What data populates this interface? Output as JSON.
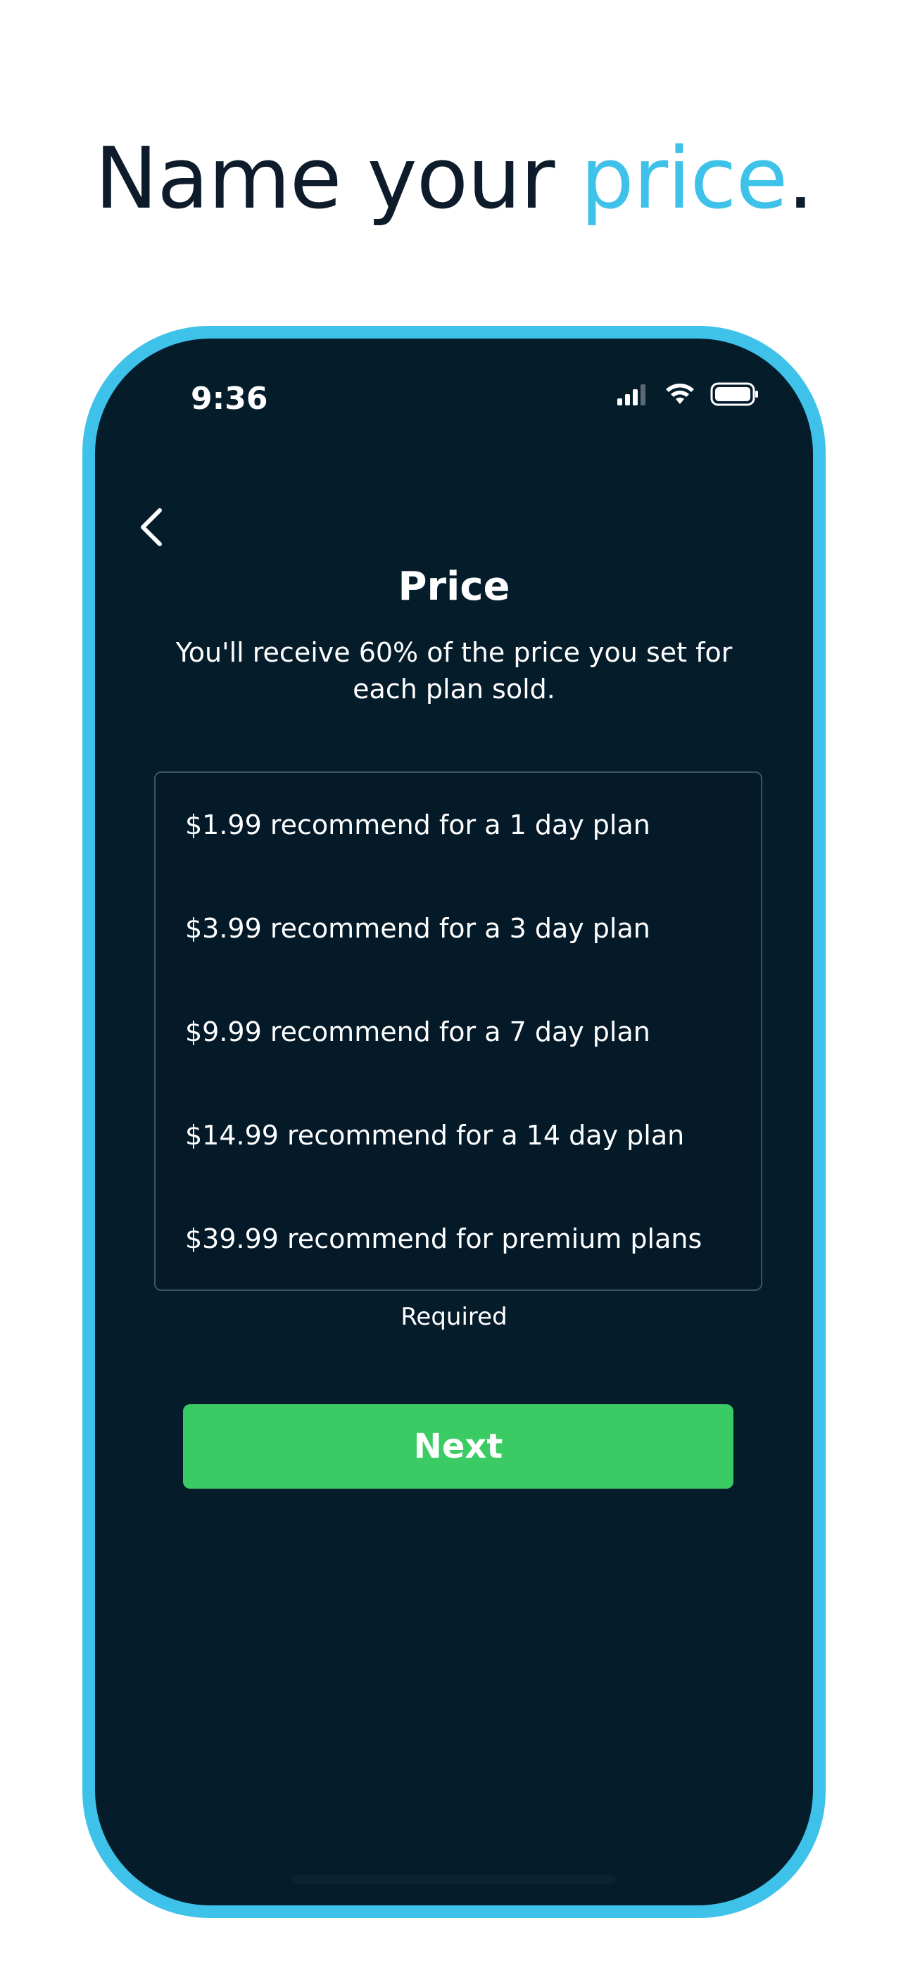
{
  "headline": {
    "text_part1": "Name your ",
    "text_accent": "price",
    "text_end": "."
  },
  "status_bar": {
    "time": "9:36"
  },
  "screen": {
    "title": "Price",
    "subtitle": "You'll receive 60% of the price you set for each plan sold.",
    "price_options": [
      "$1.99 recommend for a 1 day plan",
      "$3.99 recommend for a 3 day plan",
      "$9.99 recommend for a 7 day plan",
      "$14.99 recommend for a 14 day plan",
      "$39.99 recommend for premium plans"
    ],
    "required_label": "Required",
    "next_label": "Next"
  },
  "colors": {
    "accent": "#3ec2ea",
    "screen_bg": "#051c2b",
    "button_green": "#3acb64",
    "headline_text": "#0d1b2a"
  },
  "icons": {
    "back": "chevron-left-icon",
    "signal": "cellular-signal-icon",
    "wifi": "wifi-icon",
    "battery": "battery-icon"
  }
}
